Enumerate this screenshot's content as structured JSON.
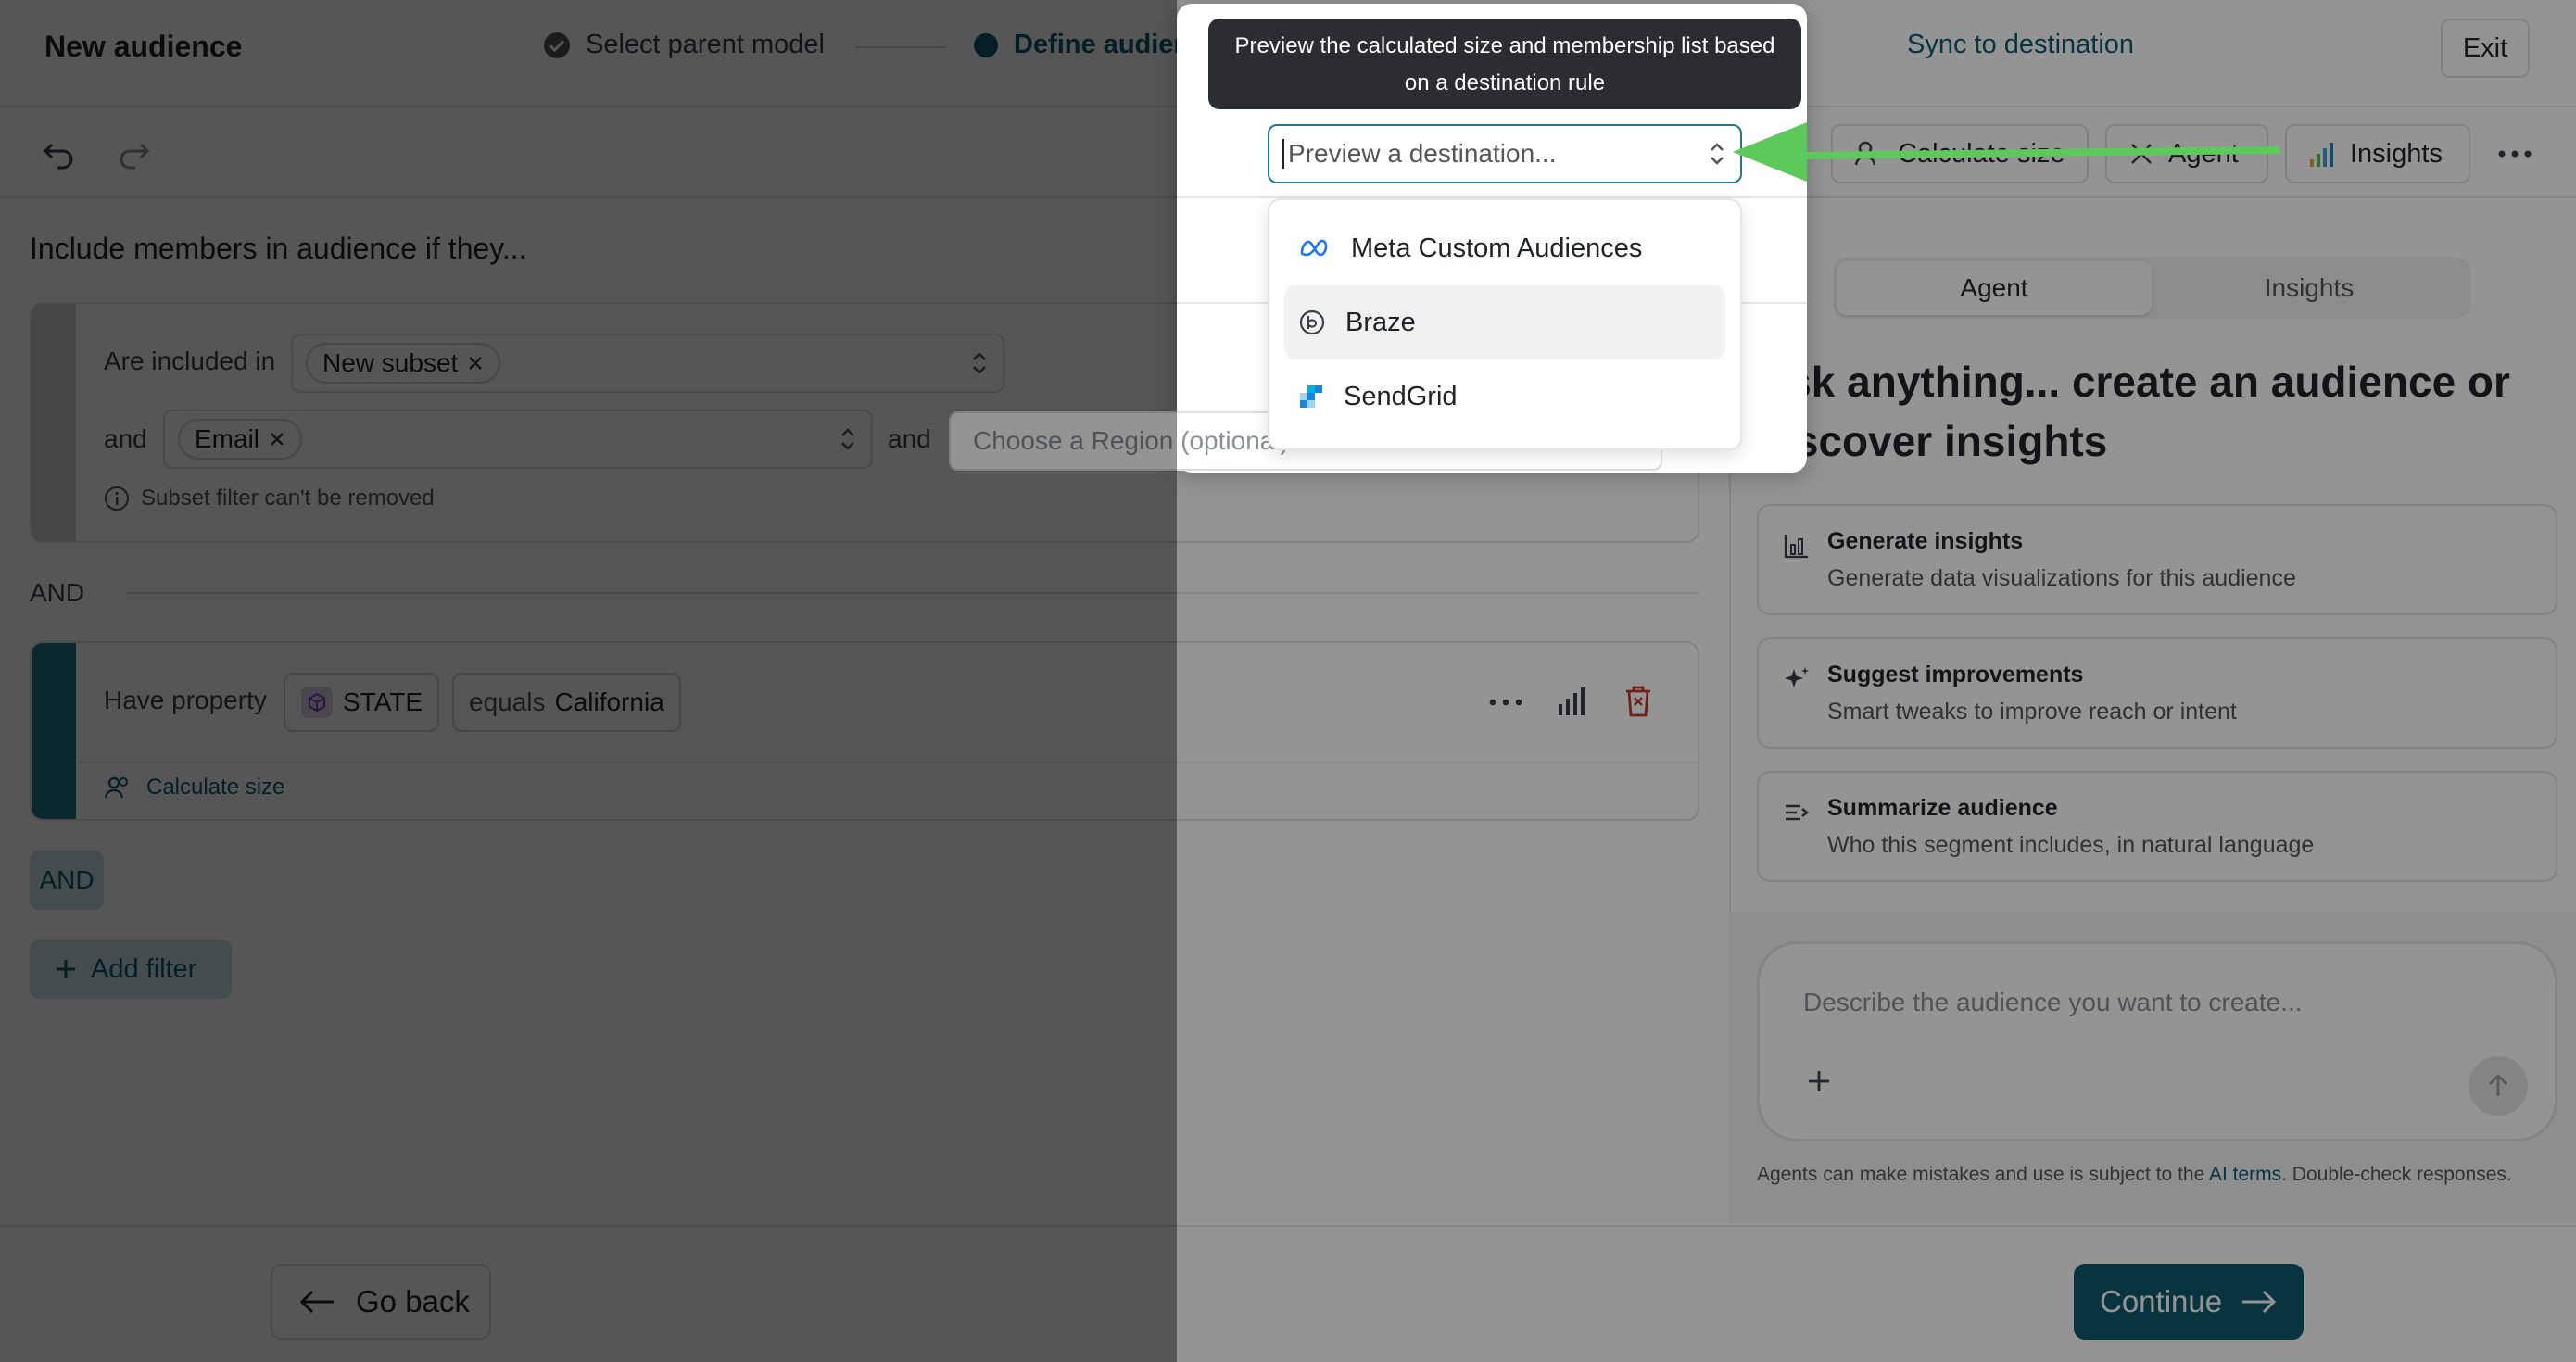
{
  "header": {
    "title": "New audience",
    "steps": [
      {
        "label": "Select parent model",
        "state": "done"
      },
      {
        "label": "Define audience",
        "state": "active"
      },
      {
        "label": "Sync to destination",
        "state": "todo"
      }
    ],
    "exit_label": "Exit"
  },
  "toolbar": {
    "calculate_label": "Calculate size",
    "agent_label": "Agent",
    "insights_label": "Insights"
  },
  "builder": {
    "heading": "Include members in audience if they...",
    "rule1": {
      "included_label": "Are included in",
      "subset_chip": "New subset",
      "and_label": "and",
      "email_chip": "Email",
      "and2_label": "and",
      "region_placeholder": "Choose a Region (optional)",
      "note": "Subset filter can't be removed"
    },
    "and_separator": "AND",
    "rule2": {
      "label": "Have property",
      "property": "STATE",
      "operator": "equals",
      "value": "California",
      "calc_link": "Calculate size"
    },
    "and_button": "AND",
    "add_filter": "Add filter"
  },
  "panel": {
    "tabs": [
      "Agent",
      "Insights"
    ],
    "active_tab": "Agent",
    "ask_heading": "Ask anything... create an audience or discover insights",
    "suggestions": [
      {
        "title": "Generate insights",
        "desc": "Generate data visualizations for this audience",
        "icon": "chart-icon"
      },
      {
        "title": "Suggest improvements",
        "desc": "Smart tweaks to improve reach or intent",
        "icon": "sparkle-icon"
      },
      {
        "title": "Summarize audience",
        "desc": "Who this segment includes, in natural language",
        "icon": "summarize-icon"
      }
    ],
    "chat_placeholder": "Describe the audience you want to create...",
    "disclaimer_pre": "Agents can make mistakes and use is subject to the ",
    "disclaimer_link": "AI terms",
    "disclaimer_post": ". Double-check responses."
  },
  "footer": {
    "back_label": "Go back",
    "continue_label": "Continue"
  },
  "popup": {
    "tooltip": "Preview the calculated size and membership list based on a destination rule",
    "preview_placeholder": "Preview a destination...",
    "options": [
      {
        "label": "Meta Custom Audiences",
        "icon": "meta-icon"
      },
      {
        "label": "Braze",
        "icon": "braze-icon"
      },
      {
        "label": "SendGrid",
        "icon": "sendgrid-icon"
      }
    ],
    "highlighted_option": "Braze"
  },
  "colors": {
    "brand": "#0e5a6e",
    "rule_bar_1": "#d0d0d0",
    "rule_bar_2": "#1f7a8c",
    "arrow": "#5cc95a",
    "delete": "#c0392b"
  }
}
